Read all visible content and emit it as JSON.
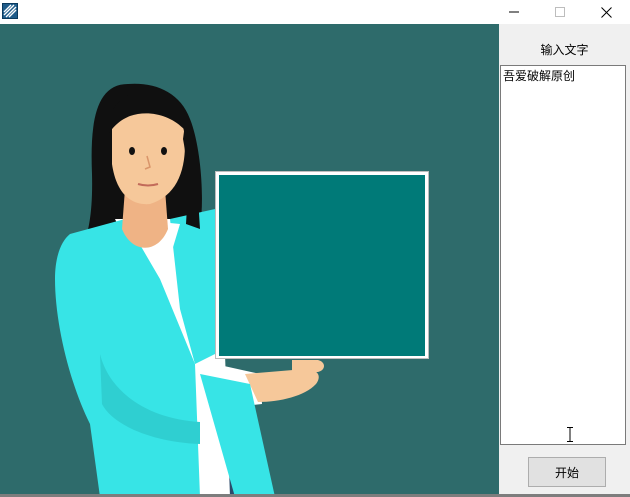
{
  "window": {
    "title": "",
    "icon": "app-icon",
    "controls": [
      "minimize-icon",
      "maximize-icon",
      "close-icon"
    ]
  },
  "canvas": {
    "background_color": "#2e6b6b",
    "illustration": "woman-holding-board",
    "board_color": "#007a78",
    "shirt_color": "#37e4e6"
  },
  "side_panel": {
    "label": "输入文字",
    "text_value": "吾爱破解原创",
    "button_label": "开始"
  }
}
